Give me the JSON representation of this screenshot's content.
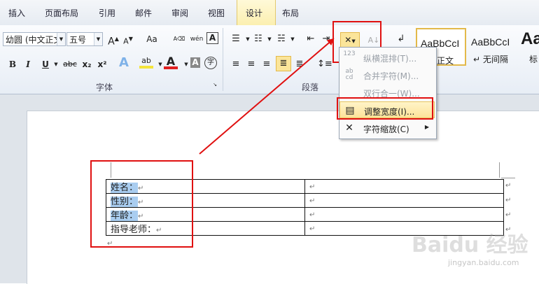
{
  "tabs": [
    {
      "label": "插入"
    },
    {
      "label": "页面布局"
    },
    {
      "label": "引用"
    },
    {
      "label": "邮件"
    },
    {
      "label": "审阅"
    },
    {
      "label": "视图"
    },
    {
      "label": "设计"
    },
    {
      "label": "布局"
    }
  ],
  "font": {
    "name": "幼圆 (中文正文)",
    "size": "五号",
    "group_label": "字体",
    "grow_label": "A",
    "case_label": "Aa",
    "pinyin_label": "wén",
    "bold": "B",
    "italic": "I",
    "underline": "U",
    "strike": "abc",
    "sub": "x₂",
    "sup": "x²",
    "color_a": "A",
    "circle": "字"
  },
  "paragraph": {
    "group_label": "段落"
  },
  "styles": [
    {
      "sample": "AaBbCcI",
      "name": "正文"
    },
    {
      "sample": "AaBbCcI",
      "name": "↵ 无间隔"
    },
    {
      "sample": "AaI",
      "name": "标"
    }
  ],
  "menu": {
    "items": [
      {
        "label": "纵横混排(T)...",
        "icon": "123",
        "enabled": false
      },
      {
        "label": "合并字符(M)...",
        "icon": "ab cd",
        "enabled": false
      },
      {
        "label": "双行合一(W)...",
        "icon": "",
        "enabled": false
      },
      {
        "label": "调整宽度(I)...",
        "icon": "",
        "enabled": true,
        "highlight": true
      },
      {
        "label": "字符缩放(C)",
        "icon": "",
        "enabled": true,
        "submenu": true
      }
    ]
  },
  "table": {
    "rows": [
      {
        "label": "姓名：",
        "value": ""
      },
      {
        "label": "性别：",
        "value": ""
      },
      {
        "label": "年龄：",
        "value": ""
      },
      {
        "label": "指导老师：",
        "value": ""
      }
    ]
  },
  "paragraph_mark": "↵",
  "watermark": {
    "brand": "Baidu 经验",
    "url": "jingyan.baidu.com"
  },
  "colors": {
    "annotation": "#e01010",
    "highlight": "#a9cdf0",
    "active_tab": "#fbefb0"
  }
}
